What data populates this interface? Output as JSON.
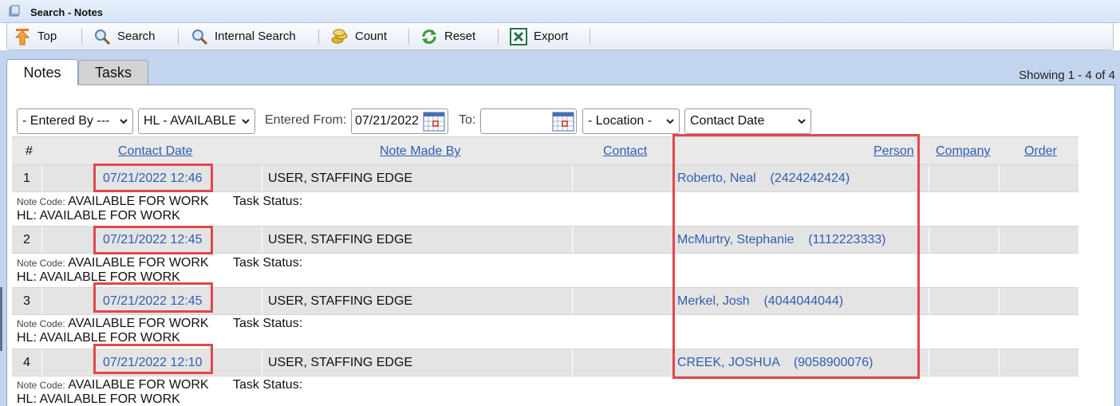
{
  "window": {
    "title": "Search - Notes"
  },
  "toolbar": {
    "top": "Top",
    "search": "Search",
    "internal_search": "Internal Search",
    "count": "Count",
    "reset": "Reset",
    "export": "Export"
  },
  "tabs": [
    {
      "label": "Notes",
      "active": true
    },
    {
      "label": "Tasks",
      "active": false
    }
  ],
  "showing": "Showing 1 - 4 of 4",
  "filters": {
    "entered_by": "- Entered By ---",
    "hl": "HL - AVAILABLE",
    "entered_from_label": "Entered From:",
    "entered_from_value": "07/21/2022",
    "to_label": "To:",
    "to_value": "",
    "location": "- Location -",
    "sort": "Contact Date"
  },
  "columns": {
    "num": "#",
    "contact_date": "Contact Date",
    "note_made_by": "Note Made By",
    "contact": "Contact",
    "person": "Person",
    "company": "Company",
    "order": "Order"
  },
  "rows": [
    {
      "num": "1",
      "date": "07/21/2022 12:46",
      "by": "USER, STAFFING EDGE",
      "person": "Roberto, Neal    (2424242424)",
      "note_code_label": "Note Code:",
      "note_code": "AVAILABLE FOR WORK",
      "task_status": "Task Status:",
      "hl": "HL: AVAILABLE FOR WORK"
    },
    {
      "num": "2",
      "date": "07/21/2022 12:45",
      "by": "USER, STAFFING EDGE",
      "person": "McMurtry, Stephanie    (1112223333)",
      "note_code_label": "Note Code:",
      "note_code": "AVAILABLE FOR WORK",
      "task_status": "Task Status:",
      "hl": "HL: AVAILABLE FOR WORK"
    },
    {
      "num": "3",
      "date": "07/21/2022 12:45",
      "by": "USER, STAFFING EDGE",
      "person": "Merkel, Josh    (4044044044)",
      "note_code_label": "Note Code:",
      "note_code": "AVAILABLE FOR WORK",
      "task_status": "Task Status:",
      "hl": "HL: AVAILABLE FOR WORK"
    },
    {
      "num": "4",
      "date": "07/21/2022 12:10",
      "by": "USER, STAFFING EDGE",
      "person": "CREEK, JOSHUA    (9058900076)",
      "note_code_label": "Note Code:",
      "note_code": "AVAILABLE FOR WORK",
      "task_status": "Task Status:",
      "hl": "HL: AVAILABLE FOR WORK"
    }
  ],
  "colors": {
    "link": "#2f5eb2",
    "highlight": "#e0474c",
    "header_bg": "#c3d4ee"
  },
  "icons": [
    "app-icon",
    "up-arrow-icon",
    "magnifier-icon",
    "magnifier-icon",
    "coins-icon",
    "refresh-icon",
    "excel-icon",
    "chevron-down-icon",
    "calendar-icon"
  ]
}
